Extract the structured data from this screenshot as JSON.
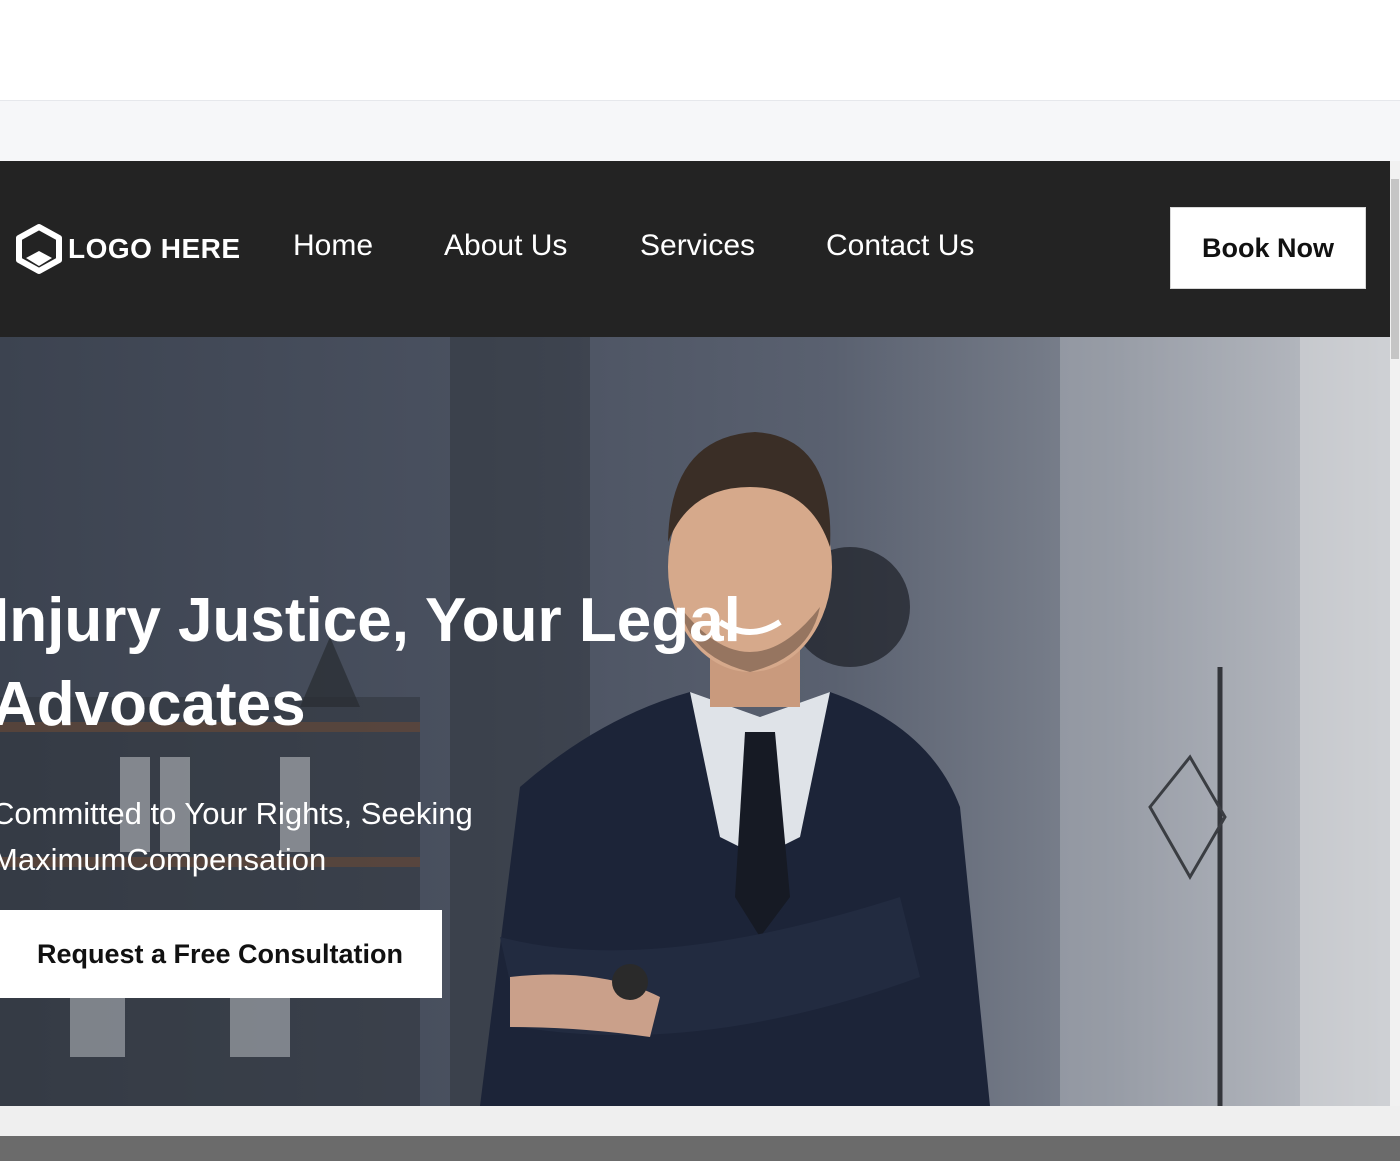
{
  "nav": {
    "logo_text": "LOGO HERE",
    "links": [
      "Home",
      "About Us",
      "Services",
      "Contact Us"
    ],
    "cta_label": "Book Now"
  },
  "hero": {
    "title_line1": "Injury Justice, Your Legal",
    "title_line2": "Advocates",
    "subtitle_line1": "Committed to Your Rights, Seeking",
    "subtitle_line2": "MaximumCompensation",
    "cta_label": "Request a Free Consultation"
  },
  "colors": {
    "navbar_bg": "#232323",
    "button_bg": "#ffffff",
    "text_light": "#ffffff",
    "text_dark": "#111111"
  }
}
